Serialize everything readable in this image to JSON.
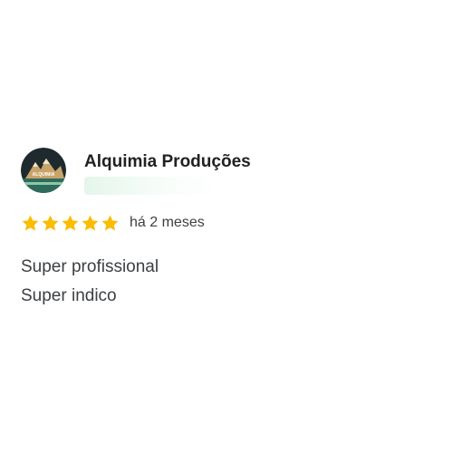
{
  "review": {
    "author_name": "Alquimia Produções",
    "avatar": {
      "icon": "mountain-logo-icon",
      "logo_text": "ALQUIMIA"
    },
    "rating": 5,
    "max_rating": 5,
    "star_color": "#fbbc04",
    "time": "há 2 meses",
    "text_lines": [
      "Super profissional",
      "Super indico"
    ]
  }
}
